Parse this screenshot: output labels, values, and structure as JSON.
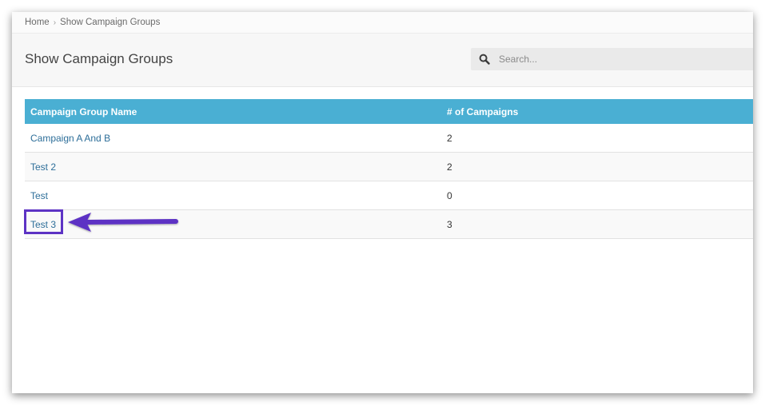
{
  "breadcrumb": {
    "home": "Home",
    "separator": "›",
    "current": "Show Campaign Groups"
  },
  "page": {
    "title": "Show Campaign Groups"
  },
  "search": {
    "placeholder": "Search...",
    "value": "",
    "icon": "search-icon"
  },
  "table": {
    "columns": [
      "Campaign Group Name",
      "# of Campaigns"
    ],
    "rows": [
      {
        "name": "Campaign A And B",
        "count": "2"
      },
      {
        "name": "Test 2",
        "count": "2"
      },
      {
        "name": "Test",
        "count": "0"
      },
      {
        "name": "Test 3",
        "count": "3"
      }
    ]
  },
  "colors": {
    "header_bg": "#4aafd3",
    "link": "#2d6e99",
    "annotation": "#5d33c4"
  }
}
